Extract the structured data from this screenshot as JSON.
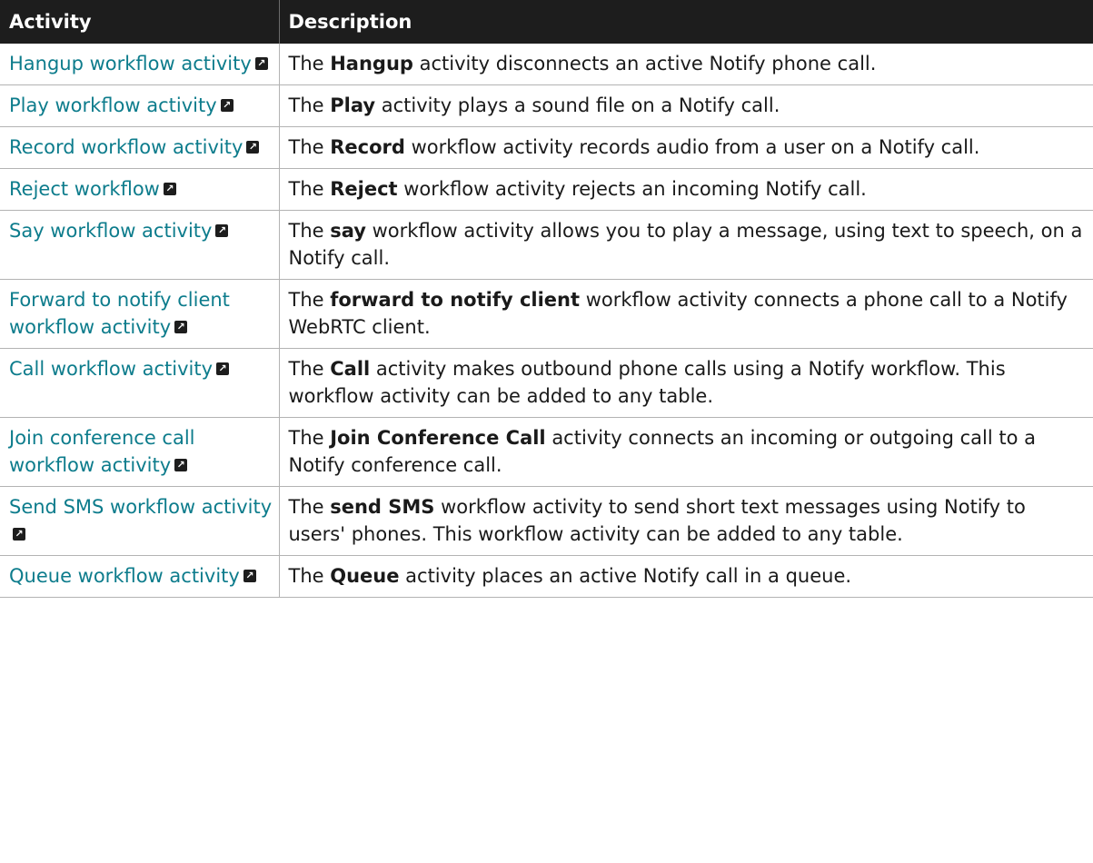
{
  "table": {
    "headers": [
      "Activity",
      "Description"
    ],
    "rows": [
      {
        "activity": "Hangup workflow activity",
        "pre": "The ",
        "keyword": "Hangup",
        "post": " activity disconnects an active Notify phone call."
      },
      {
        "activity": "Play workflow activity",
        "pre": "The ",
        "keyword": "Play",
        "post": " activity plays a sound file on a Notify call."
      },
      {
        "activity": "Record workflow activity",
        "pre": "The ",
        "keyword": "Record",
        "post": " workflow activity records audio from a user on a Notify call."
      },
      {
        "activity": "Reject workflow",
        "pre": "The ",
        "keyword": "Reject",
        "post": " workflow activity rejects an incoming Notify call."
      },
      {
        "activity": "Say workflow activity",
        "pre": "The ",
        "keyword": "say",
        "post": " workflow activity allows you to play a message, using text to speech, on a Notify call."
      },
      {
        "activity": "Forward to notify client workflow activity",
        "pre": "The ",
        "keyword": "forward to notify client",
        "post": " workflow activity connects a phone call to a Notify WebRTC client."
      },
      {
        "activity": "Call workflow activity",
        "pre": "The ",
        "keyword": "Call",
        "post": " activity makes outbound phone calls using a Notify workflow. This workflow activity can be added to any table."
      },
      {
        "activity": "Join conference call workflow activity",
        "pre": "The ",
        "keyword": "Join Conference Call",
        "post": " activity connects an incoming or outgoing call to a Notify conference call."
      },
      {
        "activity": "Send SMS workflow activity",
        "pre": "The ",
        "keyword": "send SMS",
        "post": " workflow activity to send short text messages using Notify to users' phones. This workflow activity can be added to any table."
      },
      {
        "activity": "Queue workflow activity",
        "pre": "The ",
        "keyword": "Queue",
        "post": " activity places an active Notify call in a queue."
      }
    ]
  },
  "icons": {
    "external_link": "external-link-icon"
  },
  "colors": {
    "header_bg": "#1d1d1d",
    "link": "#0d7c8c",
    "border": "#b3b3b3"
  }
}
